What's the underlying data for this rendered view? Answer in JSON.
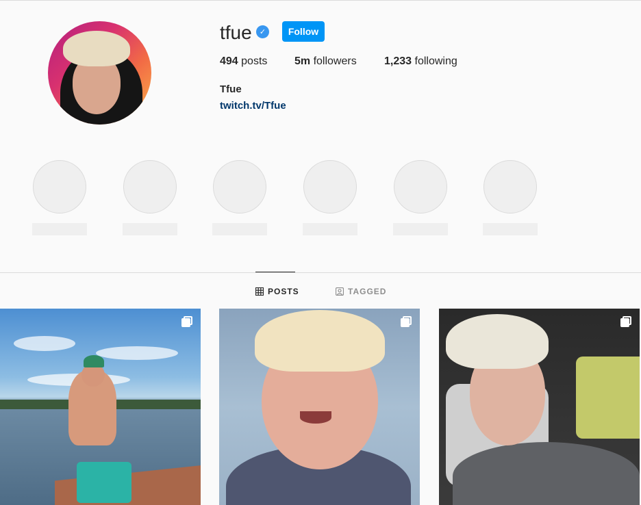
{
  "profile": {
    "username": "tfue",
    "verified_icon": "verified-badge-icon",
    "follow_label": "Follow",
    "stats": {
      "posts_count": "494",
      "posts_label": "posts",
      "followers_count": "5m",
      "followers_label": "followers",
      "following_count": "1,233",
      "following_label": "following"
    },
    "full_name": "Tfue",
    "link": "twitch.tv/Tfue"
  },
  "tabs": {
    "posts_label": "POSTS",
    "tagged_label": "TAGGED"
  },
  "colors": {
    "accent": "#0095f6",
    "link": "#00376b",
    "background": "#fafafa"
  }
}
